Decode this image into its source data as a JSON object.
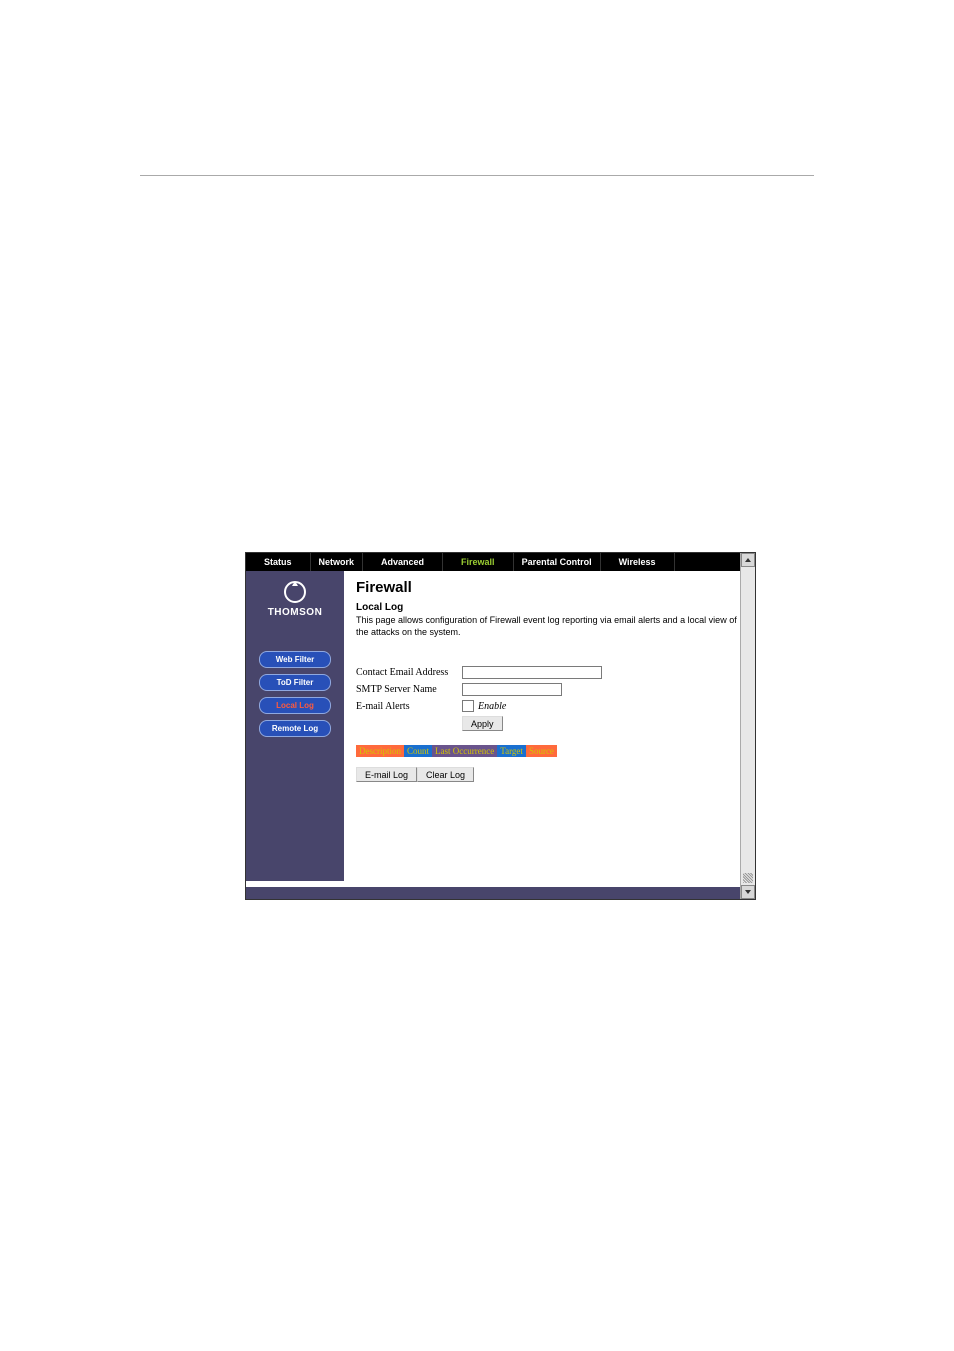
{
  "topnav": {
    "tabs": [
      {
        "label": "Status",
        "active": false
      },
      {
        "label": "Network",
        "active": false
      },
      {
        "label": "Advanced",
        "active": false
      },
      {
        "label": "Firewall",
        "active": true
      },
      {
        "label": "Parental Control",
        "active": false
      },
      {
        "label": "Wireless",
        "active": false
      }
    ]
  },
  "brand": {
    "name": "THOMSON"
  },
  "sidebar": {
    "items": [
      {
        "label": "Web Filter",
        "active": false
      },
      {
        "label": "ToD Filter",
        "active": false
      },
      {
        "label": "Local Log",
        "active": true
      },
      {
        "label": "Remote Log",
        "active": false
      }
    ]
  },
  "content": {
    "title": "Firewall",
    "subtitle": "Local Log",
    "description": "This page allows configuration of Firewall event log reporting via email alerts and a local view of the attacks on the system.",
    "fields": {
      "contact_email_label": "Contact Email Address",
      "contact_email_value": "",
      "smtp_label": "SMTP Server Name",
      "smtp_value": "",
      "alerts_label": "E-mail Alerts",
      "enable_label": "Enable"
    },
    "apply_btn": "Apply",
    "table_headers": [
      "Description",
      "Count",
      "Last Occurrence",
      "Target",
      "Source"
    ],
    "email_log_btn": "E-mail Log",
    "clear_log_btn": "Clear Log"
  }
}
